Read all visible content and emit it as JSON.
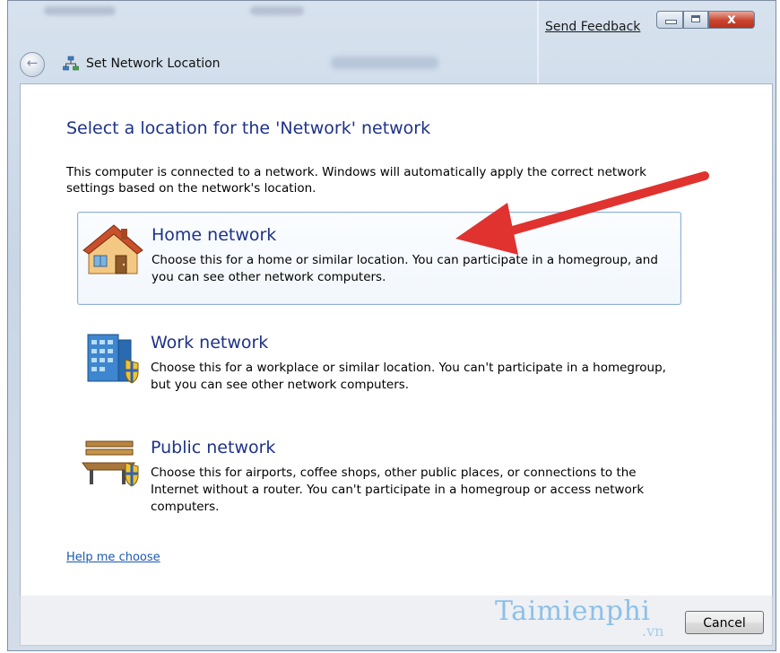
{
  "window": {
    "title": "Set Network Location",
    "send_feedback": "Send Feedback",
    "close_glyph": "x"
  },
  "main": {
    "heading": "Select a location for the 'Network' network",
    "intro": "This computer is connected to a network. Windows will automatically apply the correct network settings based on the network's location.",
    "options": [
      {
        "title": "Home network",
        "description": "Choose this for a home or similar location. You can participate in a homegroup, and you can see other network computers.",
        "icon": "house-icon"
      },
      {
        "title": "Work network",
        "description": "Choose this for a workplace or similar location. You can't participate in a homegroup, but you can see other network computers.",
        "icon": "office-building-shield-icon"
      },
      {
        "title": "Public network",
        "description": "Choose this for airports, coffee shops, other public places, or connections to the Internet without a router. You can't participate in a homegroup or access network computers.",
        "icon": "park-bench-shield-icon"
      }
    ],
    "help_link": "Help me choose"
  },
  "footer": {
    "cancel_label": "Cancel",
    "watermark": "Taimienphi",
    "watermark_sub": ".vn"
  },
  "colors": {
    "heading_blue": "#1e3287",
    "link_blue": "#1a59b3",
    "arrow_red": "#e0322f"
  }
}
